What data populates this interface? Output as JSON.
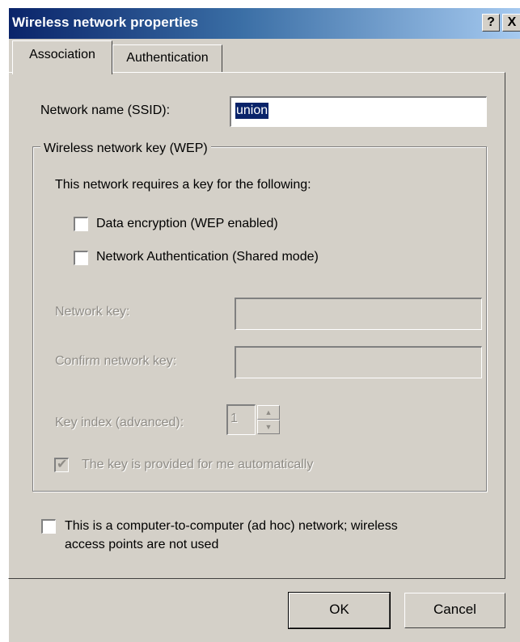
{
  "window": {
    "title": "Wireless network properties",
    "help_label": "?",
    "close_label": "X"
  },
  "tabs": [
    {
      "label": "Association",
      "selected": true
    },
    {
      "label": "Authentication",
      "selected": false
    }
  ],
  "ssid": {
    "label": "Network name (SSID):",
    "value": "union"
  },
  "wep_group": {
    "title": "Wireless network key (WEP)",
    "description": "This network requires a key for the following:",
    "data_encryption": {
      "label": "Data encryption (WEP enabled)",
      "checked": false
    },
    "network_auth": {
      "label": "Network Authentication (Shared mode)",
      "checked": false
    },
    "network_key": {
      "label": "Network key:",
      "value": ""
    },
    "confirm_key": {
      "label": "Confirm network key:",
      "value": ""
    },
    "key_index": {
      "label": "Key index (advanced):",
      "value": "1"
    },
    "auto_key": {
      "label": "The key is provided for me automatically",
      "checked": true
    }
  },
  "adhoc": {
    "line1": "This is a computer-to-computer (ad hoc) network; wireless",
    "line2": "access points are not used",
    "checked": false
  },
  "buttons": {
    "ok": "OK",
    "cancel": "Cancel"
  },
  "colors": {
    "dialog_face": "#d4d0c8",
    "title_start": "#0a246a",
    "title_end": "#a6caf0",
    "selection": "#0a246a",
    "disabled_text": "#8f8c86"
  }
}
